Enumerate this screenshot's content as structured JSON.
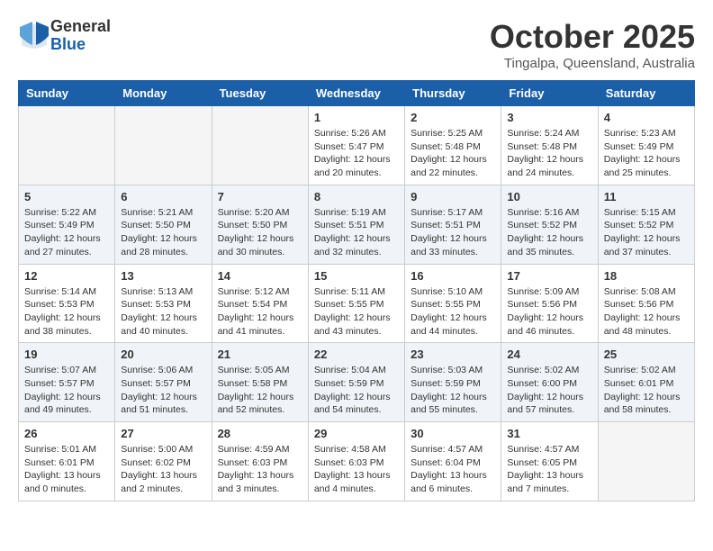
{
  "header": {
    "logo": {
      "general": "General",
      "blue": "Blue"
    },
    "title": "October 2025",
    "subtitle": "Tingalpa, Queensland, Australia"
  },
  "days_of_week": [
    "Sunday",
    "Monday",
    "Tuesday",
    "Wednesday",
    "Thursday",
    "Friday",
    "Saturday"
  ],
  "weeks": [
    [
      {
        "day": "",
        "info": ""
      },
      {
        "day": "",
        "info": ""
      },
      {
        "day": "",
        "info": ""
      },
      {
        "day": "1",
        "info": "Sunrise: 5:26 AM\nSunset: 5:47 PM\nDaylight: 12 hours\nand 20 minutes."
      },
      {
        "day": "2",
        "info": "Sunrise: 5:25 AM\nSunset: 5:48 PM\nDaylight: 12 hours\nand 22 minutes."
      },
      {
        "day": "3",
        "info": "Sunrise: 5:24 AM\nSunset: 5:48 PM\nDaylight: 12 hours\nand 24 minutes."
      },
      {
        "day": "4",
        "info": "Sunrise: 5:23 AM\nSunset: 5:49 PM\nDaylight: 12 hours\nand 25 minutes."
      }
    ],
    [
      {
        "day": "5",
        "info": "Sunrise: 5:22 AM\nSunset: 5:49 PM\nDaylight: 12 hours\nand 27 minutes."
      },
      {
        "day": "6",
        "info": "Sunrise: 5:21 AM\nSunset: 5:50 PM\nDaylight: 12 hours\nand 28 minutes."
      },
      {
        "day": "7",
        "info": "Sunrise: 5:20 AM\nSunset: 5:50 PM\nDaylight: 12 hours\nand 30 minutes."
      },
      {
        "day": "8",
        "info": "Sunrise: 5:19 AM\nSunset: 5:51 PM\nDaylight: 12 hours\nand 32 minutes."
      },
      {
        "day": "9",
        "info": "Sunrise: 5:17 AM\nSunset: 5:51 PM\nDaylight: 12 hours\nand 33 minutes."
      },
      {
        "day": "10",
        "info": "Sunrise: 5:16 AM\nSunset: 5:52 PM\nDaylight: 12 hours\nand 35 minutes."
      },
      {
        "day": "11",
        "info": "Sunrise: 5:15 AM\nSunset: 5:52 PM\nDaylight: 12 hours\nand 37 minutes."
      }
    ],
    [
      {
        "day": "12",
        "info": "Sunrise: 5:14 AM\nSunset: 5:53 PM\nDaylight: 12 hours\nand 38 minutes."
      },
      {
        "day": "13",
        "info": "Sunrise: 5:13 AM\nSunset: 5:53 PM\nDaylight: 12 hours\nand 40 minutes."
      },
      {
        "day": "14",
        "info": "Sunrise: 5:12 AM\nSunset: 5:54 PM\nDaylight: 12 hours\nand 41 minutes."
      },
      {
        "day": "15",
        "info": "Sunrise: 5:11 AM\nSunset: 5:55 PM\nDaylight: 12 hours\nand 43 minutes."
      },
      {
        "day": "16",
        "info": "Sunrise: 5:10 AM\nSunset: 5:55 PM\nDaylight: 12 hours\nand 44 minutes."
      },
      {
        "day": "17",
        "info": "Sunrise: 5:09 AM\nSunset: 5:56 PM\nDaylight: 12 hours\nand 46 minutes."
      },
      {
        "day": "18",
        "info": "Sunrise: 5:08 AM\nSunset: 5:56 PM\nDaylight: 12 hours\nand 48 minutes."
      }
    ],
    [
      {
        "day": "19",
        "info": "Sunrise: 5:07 AM\nSunset: 5:57 PM\nDaylight: 12 hours\nand 49 minutes."
      },
      {
        "day": "20",
        "info": "Sunrise: 5:06 AM\nSunset: 5:57 PM\nDaylight: 12 hours\nand 51 minutes."
      },
      {
        "day": "21",
        "info": "Sunrise: 5:05 AM\nSunset: 5:58 PM\nDaylight: 12 hours\nand 52 minutes."
      },
      {
        "day": "22",
        "info": "Sunrise: 5:04 AM\nSunset: 5:59 PM\nDaylight: 12 hours\nand 54 minutes."
      },
      {
        "day": "23",
        "info": "Sunrise: 5:03 AM\nSunset: 5:59 PM\nDaylight: 12 hours\nand 55 minutes."
      },
      {
        "day": "24",
        "info": "Sunrise: 5:02 AM\nSunset: 6:00 PM\nDaylight: 12 hours\nand 57 minutes."
      },
      {
        "day": "25",
        "info": "Sunrise: 5:02 AM\nSunset: 6:01 PM\nDaylight: 12 hours\nand 58 minutes."
      }
    ],
    [
      {
        "day": "26",
        "info": "Sunrise: 5:01 AM\nSunset: 6:01 PM\nDaylight: 13 hours\nand 0 minutes."
      },
      {
        "day": "27",
        "info": "Sunrise: 5:00 AM\nSunset: 6:02 PM\nDaylight: 13 hours\nand 2 minutes."
      },
      {
        "day": "28",
        "info": "Sunrise: 4:59 AM\nSunset: 6:03 PM\nDaylight: 13 hours\nand 3 minutes."
      },
      {
        "day": "29",
        "info": "Sunrise: 4:58 AM\nSunset: 6:03 PM\nDaylight: 13 hours\nand 4 minutes."
      },
      {
        "day": "30",
        "info": "Sunrise: 4:57 AM\nSunset: 6:04 PM\nDaylight: 13 hours\nand 6 minutes."
      },
      {
        "day": "31",
        "info": "Sunrise: 4:57 AM\nSunset: 6:05 PM\nDaylight: 13 hours\nand 7 minutes."
      },
      {
        "day": "",
        "info": ""
      }
    ]
  ]
}
